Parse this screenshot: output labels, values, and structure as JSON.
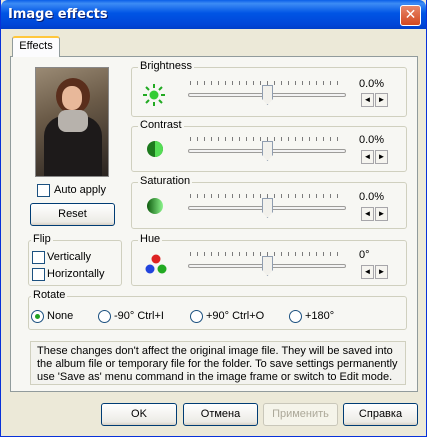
{
  "window": {
    "title": "Image effects",
    "close_glyph": "✕"
  },
  "tabs": [
    {
      "label": "Effects"
    }
  ],
  "preview": {
    "auto_apply_label": "Auto apply",
    "auto_apply_checked": false,
    "reset_label": "Reset"
  },
  "adjustments": [
    {
      "name": "Brightness",
      "value": "0.0%",
      "level": 0.5,
      "icon": "brightness-sun-icon"
    },
    {
      "name": "Contrast",
      "value": "0.0%",
      "level": 0.5,
      "icon": "contrast-icon"
    },
    {
      "name": "Saturation",
      "value": "0.0%",
      "level": 0.5,
      "icon": "saturation-icon"
    },
    {
      "name": "Hue",
      "value": "0°",
      "level": 0.5,
      "icon": "hue-rgb-icon"
    }
  ],
  "spin": {
    "left": "◄",
    "right": "►"
  },
  "flip": {
    "title": "Flip",
    "vertically": "Vertically",
    "horizontally": "Horizontally"
  },
  "rotate": {
    "title": "Rotate",
    "options": [
      "None",
      "-90° Ctrl+I",
      "+90° Ctrl+O",
      "+180°"
    ],
    "selected": "None"
  },
  "info_text": "These changes don't affect the original image file. They will be saved into the album file or temporary file for the folder. To save settings permanently use 'Save as' menu command in the image frame or switch to Edit mode.",
  "buttons": {
    "ok": "OK",
    "cancel": "Отмена",
    "apply": "Применить",
    "help": "Справка"
  },
  "colors": {
    "title_bar": "#0055e5",
    "sun_icon": "#33cc33",
    "radio_dot": "#21a121"
  }
}
